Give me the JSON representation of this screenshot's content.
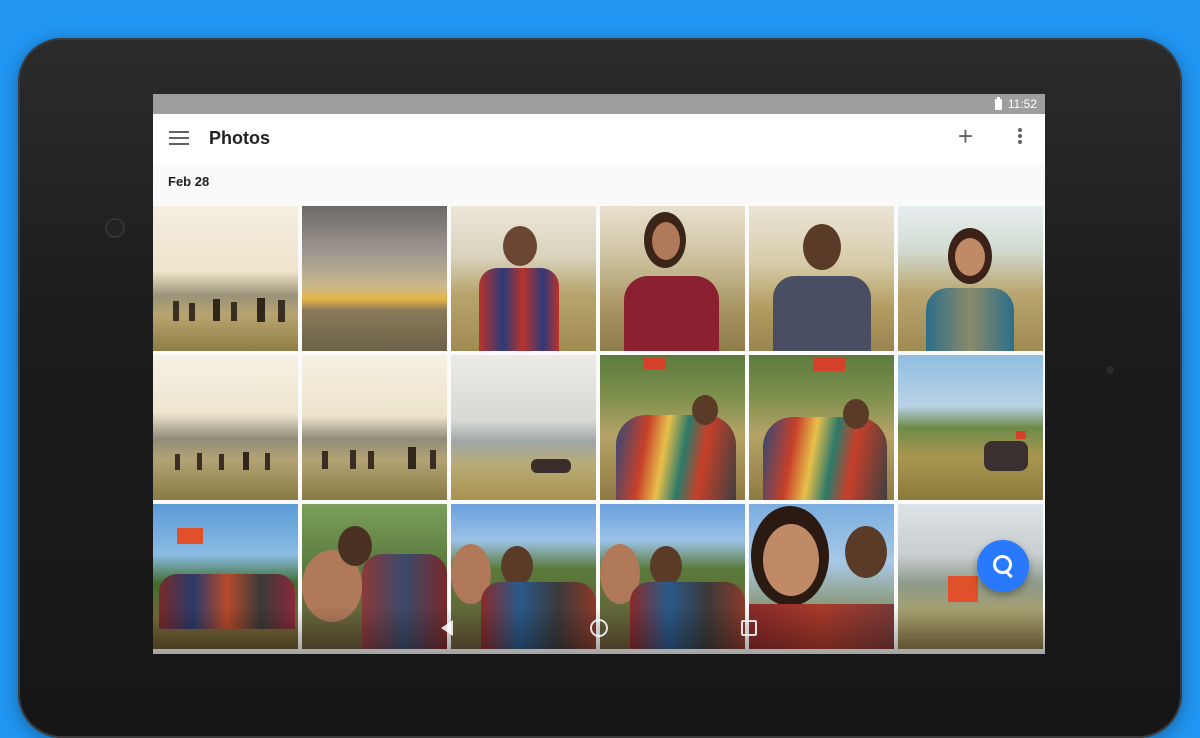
{
  "status_bar": {
    "time": "11:52",
    "battery_icon": "battery-icon"
  },
  "app_bar": {
    "title": "Photos",
    "menu_icon": "hamburger-menu-icon",
    "add_icon": "plus-icon",
    "more_icon": "more-vert-icon"
  },
  "gallery": {
    "date_header": "Feb 28",
    "photos": [
      {
        "name": "photo-group-hike-1"
      },
      {
        "name": "photo-sunset-sky"
      },
      {
        "name": "photo-man-sunglasses-portrait"
      },
      {
        "name": "photo-woman-portrait-1"
      },
      {
        "name": "photo-man-hoodie-portrait"
      },
      {
        "name": "photo-woman-portrait-2"
      },
      {
        "name": "photo-group-hike-2"
      },
      {
        "name": "photo-group-hike-3"
      },
      {
        "name": "photo-hillside-group"
      },
      {
        "name": "photo-flag-friends-1"
      },
      {
        "name": "photo-flag-friends-2"
      },
      {
        "name": "photo-hill-group-far"
      },
      {
        "name": "photo-group-with-flag"
      },
      {
        "name": "photo-group-selfie-1"
      },
      {
        "name": "photo-group-selfie-2"
      },
      {
        "name": "photo-group-selfie-3"
      },
      {
        "name": "photo-couple-selfie"
      },
      {
        "name": "photo-flag-hill"
      }
    ]
  },
  "fab": {
    "icon": "search-icon"
  },
  "nav_bar": {
    "back_icon": "back-icon",
    "home_icon": "home-icon",
    "recents_icon": "recents-icon"
  },
  "colors": {
    "background": "#2196F3",
    "fab": "#2979FF",
    "status_bar": "#9e9e9e"
  }
}
